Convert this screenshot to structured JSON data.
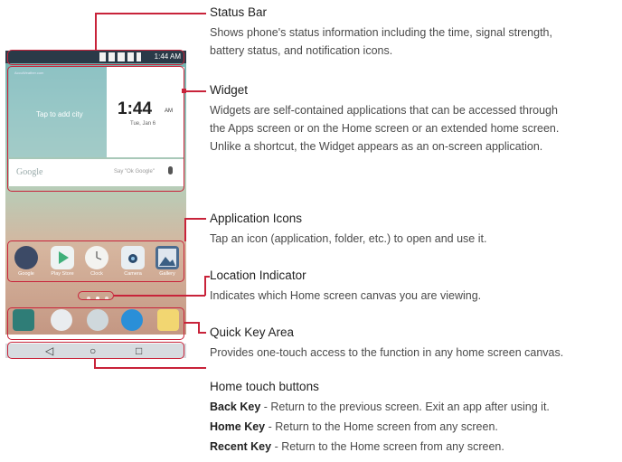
{
  "phone": {
    "status_time": "1:44 AM",
    "weather_tiny_label": "AccuWeather.com",
    "tap_to_add_city": "Tap to add city",
    "clock_time": "1:44",
    "clock_ampm": "AM",
    "clock_date": "Tue, Jan 6",
    "search_logo": "Google",
    "search_hint": "Say \"Ok Google\"",
    "apps": [
      {
        "label": "Google",
        "icon": "google-folder-icon",
        "color": "#3c4a66"
      },
      {
        "label": "Play Store",
        "icon": "play-store-icon",
        "color": "#eef3f3"
      },
      {
        "label": "Clock",
        "icon": "clock-icon",
        "color": "#f3f3f0"
      },
      {
        "label": "Camera",
        "icon": "camera-icon",
        "color": "#e8eef2"
      },
      {
        "label": "Gallery",
        "icon": "gallery-icon",
        "color": "#4a6b8f"
      }
    ],
    "quick_keys": [
      {
        "icon": "phone-icon",
        "color": "#2f7d77"
      },
      {
        "icon": "contacts-icon",
        "color": "#e9ecef"
      },
      {
        "icon": "apps-icon",
        "color": "#cfd8dc"
      },
      {
        "icon": "internet-icon",
        "color": "#2a8fd8"
      },
      {
        "icon": "messaging-icon",
        "color": "#f2d671"
      }
    ],
    "nav_back": "◁",
    "nav_home": "○",
    "nav_recent": "□"
  },
  "callouts": {
    "status_bar": {
      "title": "Status Bar",
      "lines": [
        "Shows phone's status information including the time, signal strength,",
        "battery status, and notification icons."
      ]
    },
    "widget": {
      "title": "Widget",
      "lines": [
        "Widgets are self-contained applications that can be accessed through",
        "the Apps screen or on the Home screen or an extended home screen.",
        "Unlike a shortcut, the Widget appears as an on-screen application."
      ]
    },
    "application_icons": {
      "title": "Application Icons",
      "lines": [
        "Tap an icon (application, folder, etc.) to open and use it."
      ]
    },
    "location_indicator": {
      "title": "Location Indicator",
      "lines": [
        "Indicates which Home screen canvas you are viewing."
      ]
    },
    "quick_key_area": {
      "title": "Quick Key Area",
      "lines": [
        "Provides one-touch access to the function in any home screen canvas."
      ]
    },
    "home_touch_buttons": {
      "title": "Home touch buttons",
      "back_label": "Back Key",
      "back_text": " - Return to the previous screen. Exit an app after using it.",
      "home_label": "Home Key",
      "home_text": " - Return to the Home screen from any screen.",
      "recent_label": "Recent Key",
      "recent_text": " - Return to the Home screen from any screen."
    }
  },
  "colors": {
    "accent": "#c8233a",
    "status_bar": "#2a3a48"
  }
}
